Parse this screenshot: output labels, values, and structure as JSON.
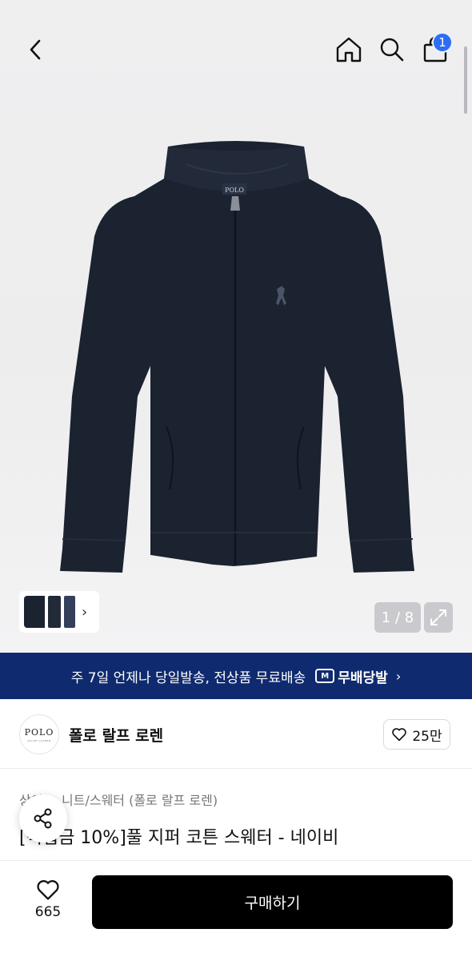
{
  "header": {
    "back_icon": "chevron-left-icon",
    "home_icon": "home-icon",
    "search_icon": "search-icon",
    "cart_icon": "shopping-bag-icon",
    "cart_badge": "1"
  },
  "gallery": {
    "counter": "1 / 8",
    "expand_icon": "expand-icon",
    "thumbnails_more_icon": "chevron-right-icon",
    "collar_tag": "POLO"
  },
  "banner": {
    "text": "주 7일 언제나 당일발송, 전상품 무료배송",
    "logo_mark": "M",
    "logo_text": "무배당발",
    "chevron": "›",
    "bg_color": "#0f2a6e"
  },
  "brand": {
    "logo_text": "POLO",
    "logo_subtext": "RALPH LAUREN",
    "name": "폴로 랄프 로렌",
    "likes": "25만"
  },
  "product": {
    "category": "상의 > 니트/스웨터 (폴로 랄프 로렌)",
    "title": "[적립금 10%]풀 지퍼 코튼 스웨터 - 네이비"
  },
  "bottom_bar": {
    "wish_count": "665",
    "buy_label": "구매하기"
  },
  "colors": {
    "accent": "#2b6ef2",
    "buy_button": "#000000",
    "sweater": "#1b2230"
  }
}
